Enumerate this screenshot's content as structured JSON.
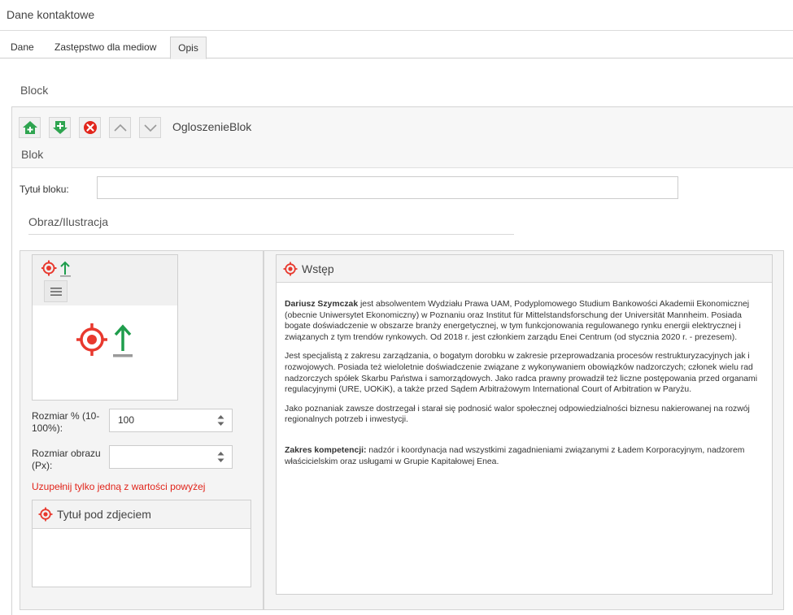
{
  "header": {
    "title": "Dane kontaktowe"
  },
  "tabs": [
    {
      "label": "Dane"
    },
    {
      "label": "Zastępstwo dla mediow"
    },
    {
      "label": "Opis"
    }
  ],
  "block": {
    "title": "Block",
    "toolbar_label": "OgloszenieBlok",
    "subtitle": "Blok",
    "title_field": {
      "label": "Tytuł bloku:",
      "value": ""
    },
    "image_section": {
      "heading": "Obraz/Ilustracja"
    },
    "size_percent": {
      "label": "Rozmiar % (10-100%):",
      "value": "100"
    },
    "size_px": {
      "label": "Rozmiar obrazu (Px):",
      "value": ""
    },
    "warning": "Uzupełnij tylko jedną z wartości powyżej",
    "caption": {
      "heading": "Tytuł pod zdjeciem"
    },
    "intro": {
      "heading": "Wstęp",
      "p1_bold": "Dariusz Szymczak",
      "p1_text": " jest absolwentem Wydziału Prawa UAM, Podyplomowego Studium Bankowości Akademii Ekonomicznej (obecnie Uniwersytet Ekonomiczny) w Poznaniu oraz Institut für Mittelstandsforschung der Universität Mannheim. Posiada bogate doświadczenie w obszarze branży energetycznej, w tym funkcjonowania regulowanego rynku energii elektrycznej i związanych z tym trendów rynkowych. Od 2018 r. jest członkiem zarządu Enei Centrum (od stycznia 2020 r. - prezesem).",
      "p2": "Jest specjalistą z zakresu zarządzania, o bogatym dorobku w zakresie przeprowadzania procesów restrukturyzacyjnych jak i rozwojowych. Posiada też wieloletnie doświadczenie związane z wykonywaniem obowiązków nadzorczych; członek wielu rad nadzorczych spółek Skarbu Państwa i samorządowych. Jako radca prawny prowadził też liczne postępowania przed organami regulacyjnymi (URE, UOKiK), a także przed Sądem Arbitrażowym International Court of Arbitration w Paryżu.",
      "p3": "Jako poznaniak zawsze dostrzegał i starał się podnosić walor społecznej odpowiedzialności biznesu nakierowanej na rozwój regionalnych potrzeb i inwestycji.",
      "p4_bold": "Zakres kompetencji:",
      "p4_text": " nadzór i koordynacja nad wszystkimi zagadnieniami związanymi z Ładem Korporacyjnym, nadzorem właścicielskim oraz usługami w Grupie Kapitałowej Enea."
    }
  },
  "colors": {
    "green": "#2ea44f",
    "red": "#e1251b",
    "target_red": "#e8392e",
    "arrow_green": "#1f9d4c",
    "gray": "#9a9a9a"
  }
}
